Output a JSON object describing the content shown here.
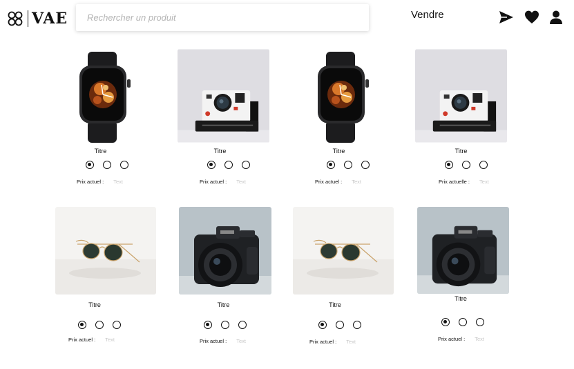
{
  "header": {
    "logo_text": "VAE",
    "search_placeholder": "Rechercher un produit",
    "sell_label": "Vendre",
    "icons": [
      "send-icon",
      "heart-icon",
      "user-icon"
    ]
  },
  "products": [
    {
      "title": "Titre",
      "price_label": "Prix actuel :",
      "price_value": "Text",
      "image": "smartwatch",
      "selected_option": 1
    },
    {
      "title": "Titre",
      "price_label": "Prix actuel :",
      "price_value": "Text",
      "image": "instant-camera",
      "selected_option": 1
    },
    {
      "title": "Titre",
      "price_label": "Prix actuel :",
      "price_value": "Text",
      "image": "smartwatch",
      "selected_option": 1
    },
    {
      "title": "Titre",
      "price_label": "Prix actuelle :",
      "price_value": "Text",
      "image": "instant-camera",
      "selected_option": 1
    },
    {
      "title": "Titre",
      "price_label": "Prix  actuel :",
      "price_value": "Text",
      "image": "sunglasses",
      "selected_option": 1
    },
    {
      "title": "Titre",
      "price_label": "Prix  actuel :",
      "price_value": "Text",
      "image": "dslr-camera",
      "selected_option": 1
    },
    {
      "title": "Titre",
      "price_label": "Prix  actuel :",
      "price_value": "Text",
      "image": "sunglasses",
      "selected_option": 1
    },
    {
      "title": "Titre",
      "price_label": "Prix actuel :",
      "price_value": "Text",
      "image": "dslr-camera",
      "selected_option": 1
    }
  ]
}
